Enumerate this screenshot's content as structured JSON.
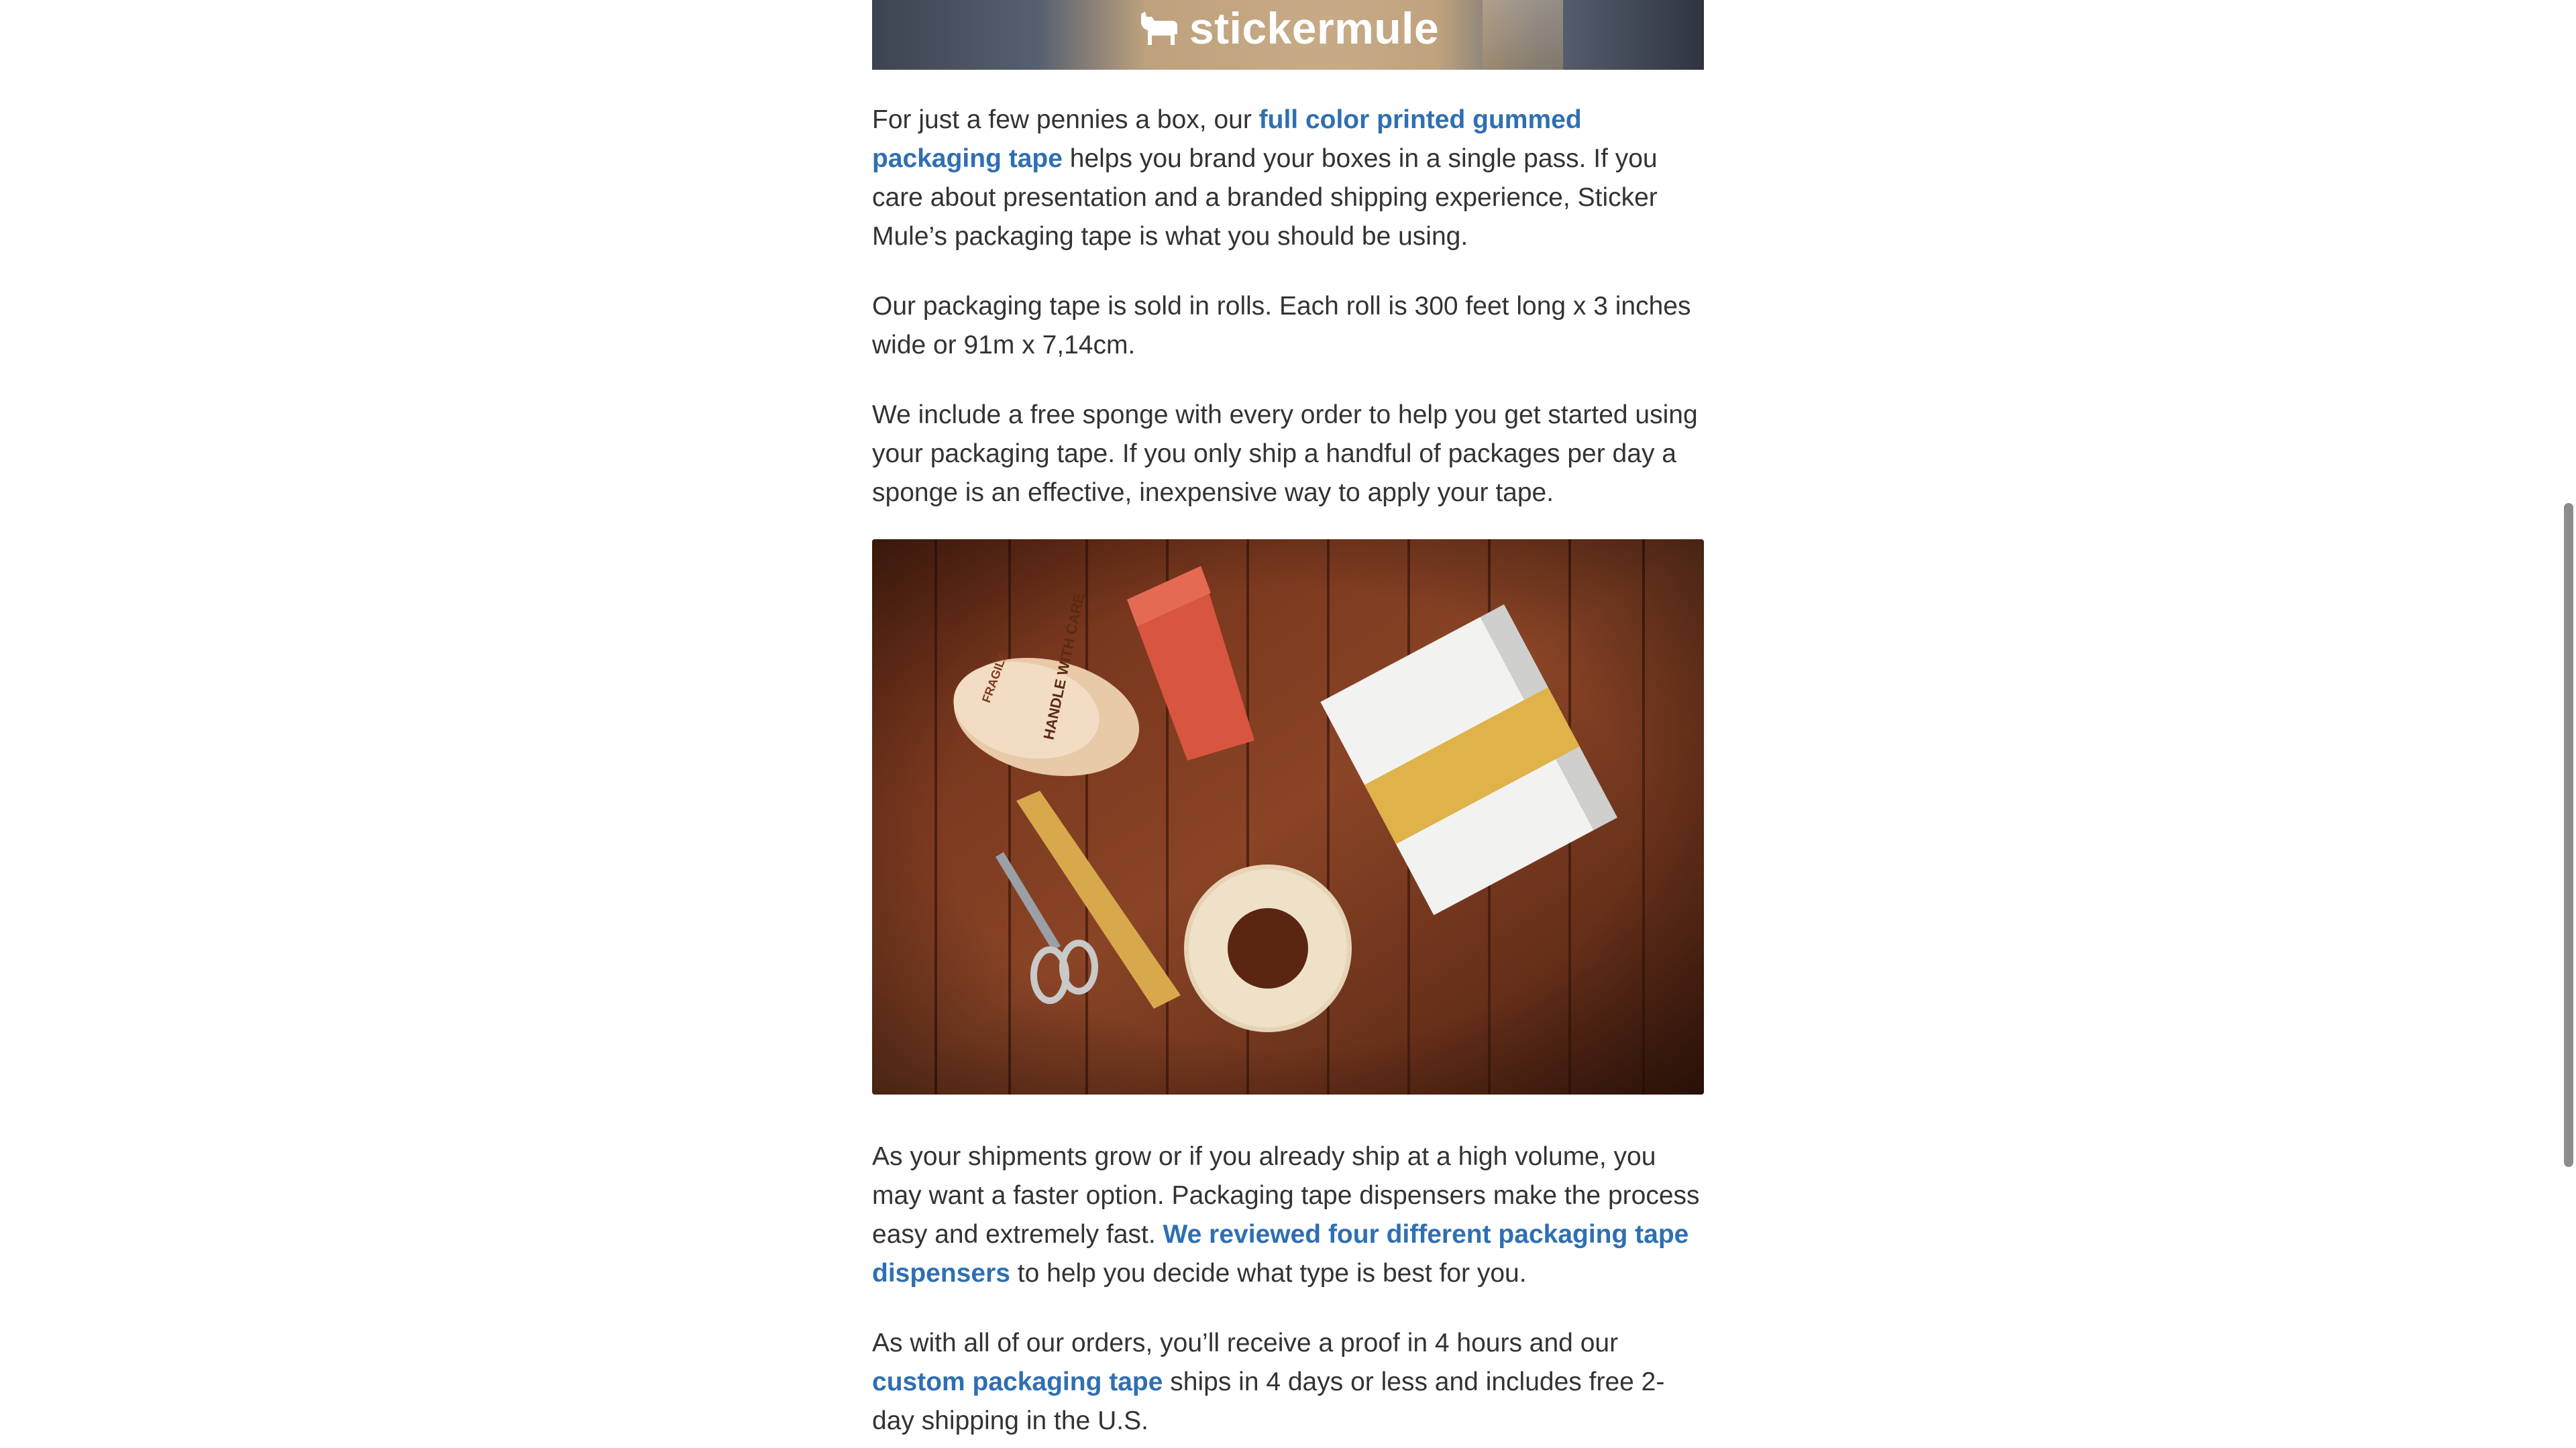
{
  "hero": {
    "logo_text": "stickermule",
    "icon": "mule-logo-icon"
  },
  "paragraphs": {
    "p1": {
      "before": "For just a few pennies a box, our ",
      "link": "full color printed gummed packaging tape",
      "after": " helps you brand your boxes in a single pass. If you care about presentation and a branded shipping experience, Sticker Mule’s packaging tape is what you should be using."
    },
    "p2": {
      "text": "Our packaging tape is sold in rolls. Each roll is 300 feet long x 3 inches wide or 91m x 7,14cm."
    },
    "p3": {
      "text": "We include a free sponge with every order to help you get started using your packaging tape. If you only ship a handful of packages per day a sponge is an effective, inexpensive way to apply your tape."
    },
    "p4": {
      "before": "As your shipments grow or if you already ship at a high volume, you may want a faster option. Packaging tape dispensers make the process easy and extremely fast. ",
      "link": "We reviewed four different packaging tape dispensers",
      "after": " to help you decide what type is best for you."
    },
    "p5": {
      "before": "As with all of our orders, you’ll receive a proof in 4 hours and our ",
      "link": "custom packaging tape",
      "after": " ships in 4 days or less and includes free 2-day shipping in the U.S."
    }
  },
  "photo": {
    "tape_labels": [
      "FRAGILE",
      "HANDLE WITH CARE"
    ]
  },
  "colors": {
    "link": "#2f6fb2",
    "body_text": "#333333",
    "wood_dark": "#4a1f10",
    "wood_light": "#8a4426"
  }
}
